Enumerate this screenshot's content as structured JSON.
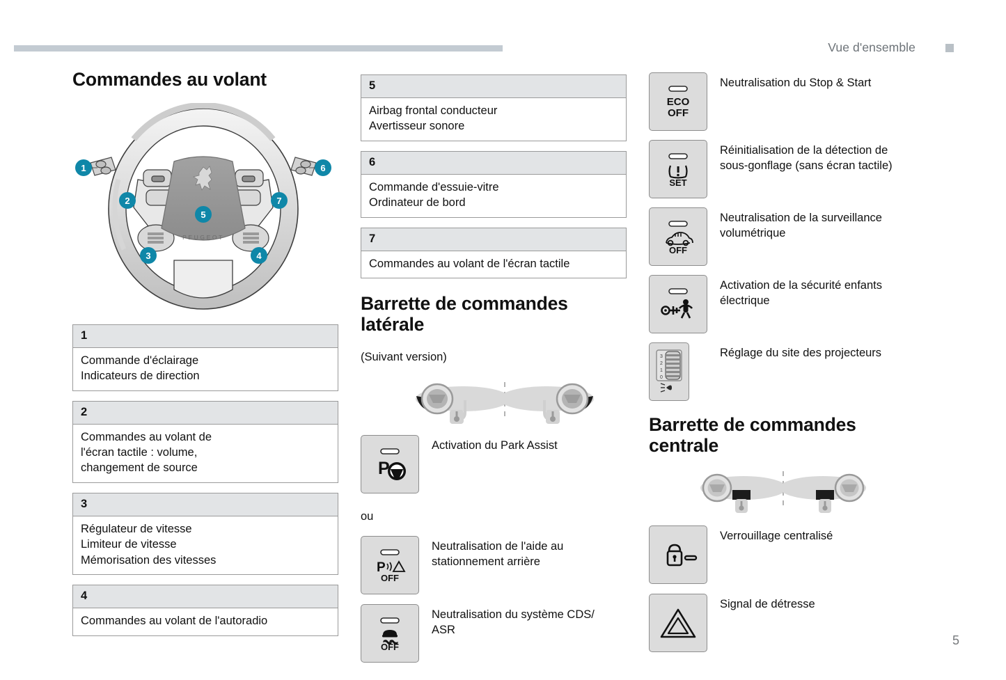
{
  "header": {
    "title": "Vue d'ensemble",
    "marker_color": "#b9c0c6",
    "bar_color": "#c3cbd2"
  },
  "page_number": "5",
  "left_column": {
    "title": "Commandes au volant",
    "diagram": {
      "name": "steering-wheel-diagram",
      "brand_text": "PEUGEOT",
      "callout_color": "#0f87a8",
      "callouts": [
        {
          "number": "1"
        },
        {
          "number": "2"
        },
        {
          "number": "3"
        },
        {
          "number": "4"
        },
        {
          "number": "5"
        },
        {
          "number": "6"
        },
        {
          "number": "7"
        }
      ]
    },
    "tables": [
      {
        "number": "1",
        "lines": [
          "Commande d'éclairage",
          "Indicateurs de direction"
        ]
      },
      {
        "number": "2",
        "lines": [
          "Commandes au volant de",
          "l'écran tactile : volume,",
          "changement de source"
        ]
      },
      {
        "number": "3",
        "lines": [
          "Régulateur de vitesse",
          "Limiteur de vitesse",
          "Mémorisation des vitesses"
        ]
      },
      {
        "number": "4",
        "lines": [
          "Commandes au volant de l'autoradio"
        ]
      }
    ]
  },
  "middle_column": {
    "tables": [
      {
        "number": "5",
        "lines": [
          "Airbag frontal conducteur",
          "Avertisseur sonore"
        ]
      },
      {
        "number": "6",
        "lines": [
          "Commande d'essuie-vitre",
          "Ordinateur de bord"
        ]
      },
      {
        "number": "7",
        "lines": [
          "Commandes au volant de l'écran tactile"
        ]
      }
    ],
    "title": "Barrette de commandes latérale",
    "subtitle": "(Suivant version)",
    "or_text": "ou",
    "buttons": [
      {
        "icon": "park-assist-icon",
        "icon_text": "P",
        "lines": [
          "Activation du Park Assist"
        ]
      },
      {
        "icon": "rear-park-sensor-off-icon",
        "icon_text": "P",
        "icon_sub": "OFF",
        "lines": [
          "Neutralisation de l'aide au",
          "stationnement arrière"
        ]
      },
      {
        "icon": "cds-asr-off-icon",
        "icon_sub": "OFF",
        "lines": [
          "Neutralisation du système CDS/",
          "ASR"
        ]
      }
    ]
  },
  "right_column": {
    "buttons_top": [
      {
        "icon": "eco-off-icon",
        "icon_text": "ECO",
        "icon_sub": "OFF",
        "lines": [
          "Neutralisation du Stop & Start"
        ]
      },
      {
        "icon": "tyre-pressure-set-icon",
        "icon_text": "(!)",
        "icon_sub": "SET",
        "lines": [
          "Réinitialisation de la détection de",
          "sous-gonflage (sans écran tactile)"
        ]
      },
      {
        "icon": "volumetric-alarm-off-icon",
        "icon_sub": "OFF",
        "lines": [
          "Neutralisation de la surveillance",
          "volumétrique"
        ]
      },
      {
        "icon": "child-lock-icon",
        "lines": [
          "Activation de la sécurité enfants",
          "électrique"
        ]
      },
      {
        "icon": "headlamp-levelling-icon",
        "lines": [
          "Réglage du site des projecteurs"
        ]
      }
    ],
    "title": "Barrette de commandes centrale",
    "buttons_bottom": [
      {
        "icon": "central-locking-icon",
        "lines": [
          "Verrouillage centralisé"
        ]
      },
      {
        "icon": "hazard-warning-icon",
        "lines": [
          "Signal de détresse"
        ]
      }
    ]
  }
}
